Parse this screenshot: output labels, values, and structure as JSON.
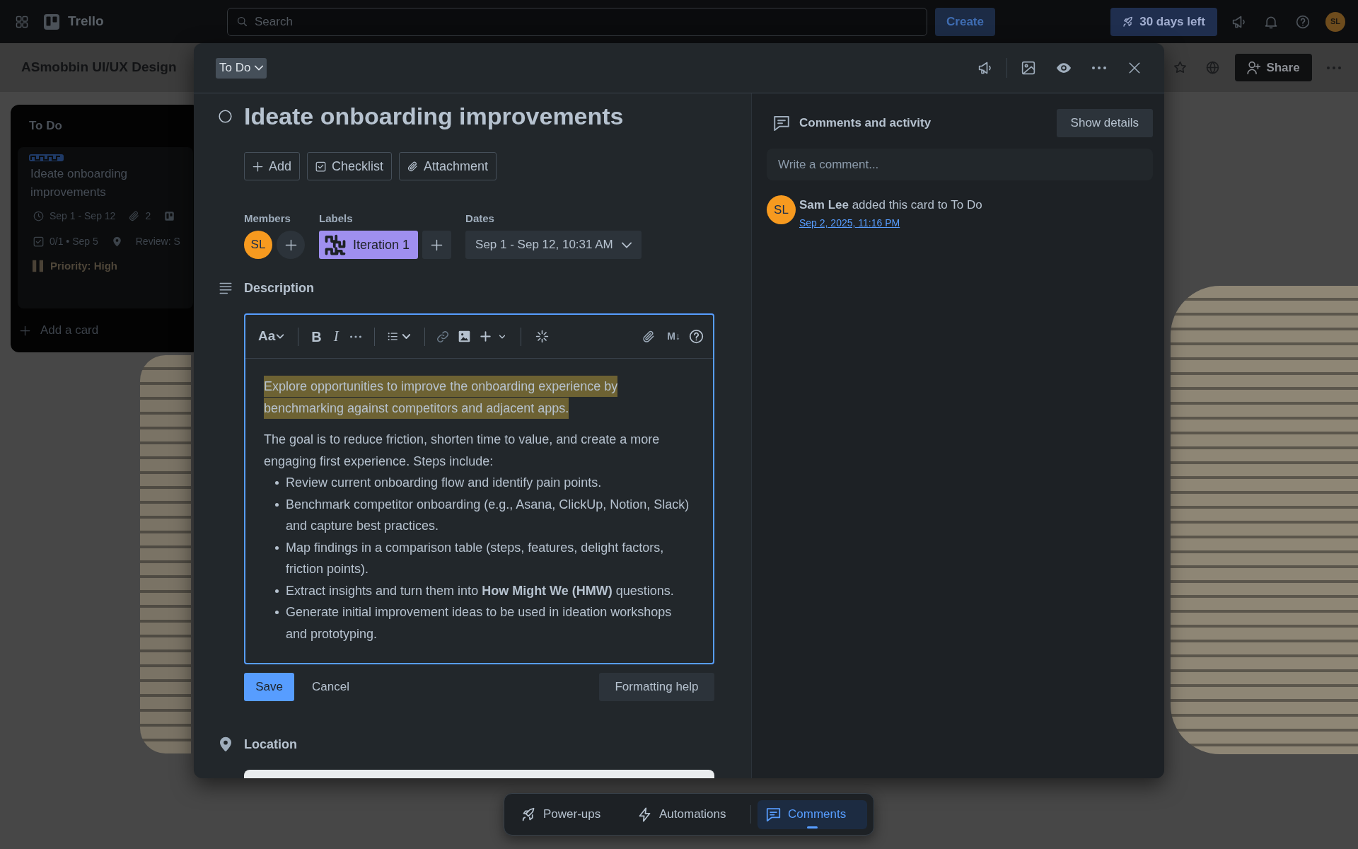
{
  "topbar": {
    "app_name": "Trello",
    "search": {
      "placeholder": "Search"
    },
    "create_button": "Create",
    "trial_button": "30 days left",
    "avatar": "SL"
  },
  "board": {
    "title": "ASmobbin UI/UX Design",
    "share_button": "Share"
  },
  "list": {
    "title": "To Do",
    "cards": [
      {
        "title": "Ideate onboarding improvements",
        "badge_rows": [
          [
            {
              "kind": "dates",
              "text": "Sep 1 - Sep 12"
            },
            {
              "kind": "attachments",
              "text": "2"
            },
            {
              "kind": "board"
            }
          ],
          [
            {
              "kind": "checklist",
              "text": "0/1 • Sep 5"
            },
            {
              "kind": "location"
            },
            {
              "kind": "field",
              "text": "Review: S"
            }
          ]
        ],
        "priority": "Priority: High"
      }
    ],
    "add_card": "Add a card"
  },
  "card_modal": {
    "list_button": "To Do",
    "completed": false,
    "title": "Ideate onboarding improvements",
    "actions": [
      {
        "kind": "add",
        "label": "Add"
      },
      {
        "kind": "checklist",
        "label": "Checklist"
      },
      {
        "kind": "attachment",
        "label": "Attachment"
      }
    ],
    "members": {
      "heading": "Members",
      "avatars": [
        "SL"
      ]
    },
    "labels": {
      "heading": "Labels",
      "items": [
        {
          "text": "Iteration 1",
          "color": "#9f8fef"
        }
      ]
    },
    "dates": {
      "heading": "Dates",
      "value": "Sep 1 - Sep 12, 10:31 AM"
    },
    "description": {
      "heading": "Description",
      "toolbar": {
        "text_style": "Aa",
        "bold": "B",
        "italic": "I",
        "markdown": "M↓"
      },
      "paragraphs": [
        {
          "text": "Explore opportunities to improve the onboarding experience by benchmarking against competitors and adjacent apps.",
          "highlighted": true
        },
        {
          "text": "The goal is to reduce friction, shorten time to value, and create a more engaging first experience. Steps include:",
          "highlighted": false
        }
      ],
      "bullets": [
        "Review current onboarding flow and identify pain points.",
        "Benchmark competitor onboarding (e.g., Asana, ClickUp, Notion, Slack) and capture best practices.",
        "Map findings in a comparison table (steps, features, delight factors, friction points).",
        "Extract insights and turn them into **How Might We (HMW)** questions.",
        "Generate initial improvement ideas to be used in ideation workshops and prototyping."
      ],
      "save_button": "Save",
      "cancel_button": "Cancel",
      "help_button": "Formatting help"
    },
    "location": {
      "heading": "Location"
    }
  },
  "activity": {
    "heading": "Comments and activity",
    "show_details_button": "Show details",
    "comment_field": {
      "placeholder": "Write a comment..."
    },
    "entries": [
      {
        "avatar": "SL",
        "text": "**Sam Lee** added this card to To Do",
        "time": "Sep 2, 2025, 11:16 PM"
      }
    ]
  },
  "dock": [
    {
      "kind": "power-ups",
      "label": "Power-ups",
      "selected": false
    },
    {
      "kind": "automations",
      "label": "Automations",
      "selected": false
    },
    {
      "kind": "comments",
      "label": "Comments",
      "selected": true
    }
  ]
}
